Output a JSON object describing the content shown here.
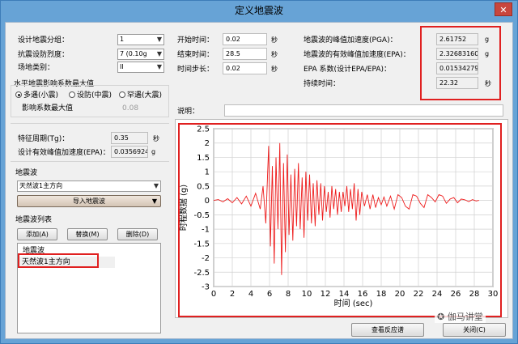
{
  "window": {
    "title": "定义地震波",
    "close": "✕"
  },
  "left": {
    "design_group_label": "设计地震分组：",
    "design_group_value": "1",
    "intensity_label": "抗震设防烈度：",
    "intensity_value": "7 (0.10g",
    "site_label": "场地类别：",
    "site_value": "II",
    "alpha_group_title": "水平地震影响系数最大值",
    "radio_frequent": "多遇(小震)",
    "radio_fortify": "设防(中震)",
    "radio_rare": "罕遇(大震)",
    "alpha_label": "影响系数最大值",
    "alpha_value": "0.08",
    "tg_label": "特征周期(Tg)：",
    "tg_value": "0.35",
    "tg_unit": "秒",
    "epa_label": "设计有效峰值加速度(EPA)：",
    "epa_value": "0.0356924",
    "epa_unit": "g",
    "wave_title": "地震波",
    "wave_select": "天然波1主方向",
    "import_button": "导入地震波",
    "list_title": "地震波列表",
    "add_button": "添加(A)",
    "replace_button": "替换(M)",
    "delete_button": "删除(D)",
    "list_header": "地震波",
    "list_items": [
      "天然波1主方向"
    ]
  },
  "time": {
    "start_label": "开始时间：",
    "start_value": "0.02",
    "start_unit": "秒",
    "end_label": "结束时间：",
    "end_value": "28.5",
    "end_unit": "秒",
    "step_label": "时间步长：",
    "step_value": "0.02",
    "step_unit": "秒"
  },
  "stats": {
    "pga_label": "地震波的峰值加速度(PGA)：",
    "pga_value": "2.61752",
    "pga_unit": "g",
    "epa_label": "地震波的有效峰值加速度(EPA)：",
    "epa_value": "2.32683160e",
    "epa_unit": "g",
    "ratio_label": "EPA 系数(设计EPA/EPA)：",
    "ratio_value": "0.01534279",
    "duration_label": "持续时间：",
    "duration_value": "22.32",
    "duration_unit": "秒"
  },
  "note_label": "说明：",
  "chart_data": {
    "type": "line",
    "xlabel": "时间 (sec)",
    "ylabel": "时程数据 (g)",
    "xlim": [
      0,
      30
    ],
    "ylim": [
      -3,
      2.5
    ],
    "xticks": [
      "0",
      "2",
      "4",
      "6",
      "8",
      "10",
      "12",
      "14",
      "16",
      "18",
      "20",
      "22",
      "24",
      "26",
      "28",
      "30"
    ],
    "yticks": [
      "2.5",
      "2",
      "1.5",
      "1",
      "0.5",
      "0",
      "-0.5",
      "-1",
      "-1.5",
      "-2",
      "-2.5",
      "-3"
    ],
    "grid": true,
    "color": "#ee1c1c",
    "x": [
      0,
      0.5,
      1,
      1.5,
      2,
      2.5,
      3,
      3.5,
      4,
      4.5,
      5,
      5.3,
      5.6,
      5.9,
      6.1,
      6.3,
      6.5,
      6.7,
      6.9,
      7.1,
      7.3,
      7.5,
      7.7,
      7.9,
      8.1,
      8.3,
      8.5,
      8.7,
      8.9,
      9.1,
      9.3,
      9.5,
      9.7,
      9.9,
      10.1,
      10.3,
      10.5,
      10.7,
      10.9,
      11.1,
      11.3,
      11.5,
      11.7,
      11.9,
      12.1,
      12.3,
      12.5,
      12.7,
      12.9,
      13.1,
      13.3,
      13.5,
      13.7,
      13.9,
      14.1,
      14.3,
      14.5,
      14.7,
      14.9,
      15.1,
      15.3,
      15.5,
      15.7,
      15.9,
      16.2,
      16.5,
      16.8,
      17.1,
      17.4,
      17.7,
      18,
      18.3,
      18.6,
      19,
      19.4,
      19.8,
      20.2,
      20.6,
      21,
      21.4,
      21.8,
      22.2,
      22.6,
      23,
      23.4,
      23.8,
      24.2,
      24.6,
      25,
      25.4,
      25.8,
      26.2,
      26.6,
      27,
      27.4,
      27.8,
      28.2,
      28.5
    ],
    "y": [
      0,
      0.03,
      -0.05,
      0.06,
      -0.08,
      0.1,
      -0.12,
      0.15,
      -0.2,
      0.25,
      -0.3,
      0.5,
      -0.8,
      1.9,
      -1.6,
      1.2,
      -2.2,
      1.5,
      -1.0,
      2.0,
      -2.6,
      1.3,
      -1.8,
      1.6,
      -1.2,
      0.9,
      -1.4,
      1.1,
      -0.9,
      1.3,
      -1.0,
      0.8,
      -1.3,
      1.0,
      -0.7,
      0.9,
      -0.8,
      0.6,
      -0.9,
      0.7,
      -0.5,
      0.6,
      -0.7,
      0.5,
      -0.4,
      0.3,
      -0.6,
      0.5,
      -0.3,
      0.4,
      -0.5,
      0.3,
      -0.4,
      0.3,
      -0.2,
      0.5,
      -0.4,
      0.4,
      -0.3,
      0.6,
      -0.7,
      0.4,
      -0.5,
      0.3,
      -0.2,
      0.2,
      -0.3,
      0.2,
      -0.25,
      0.1,
      -0.15,
      0.12,
      -0.2,
      0.15,
      -0.3,
      0.2,
      0.1,
      -0.2,
      -0.3,
      0.2,
      0.15,
      -0.1,
      -0.25,
      0.2,
      0.1,
      -0.05,
      0.2,
      0.15,
      -0.1,
      0.05,
      0.1,
      -0.08,
      0.05,
      0.02,
      -0.04,
      0.03,
      -0.02,
      0.0
    ]
  },
  "footer": {
    "response_button": "查看反应谱",
    "close_button": "关闭(C)"
  },
  "watermark": "伽马讲堂"
}
